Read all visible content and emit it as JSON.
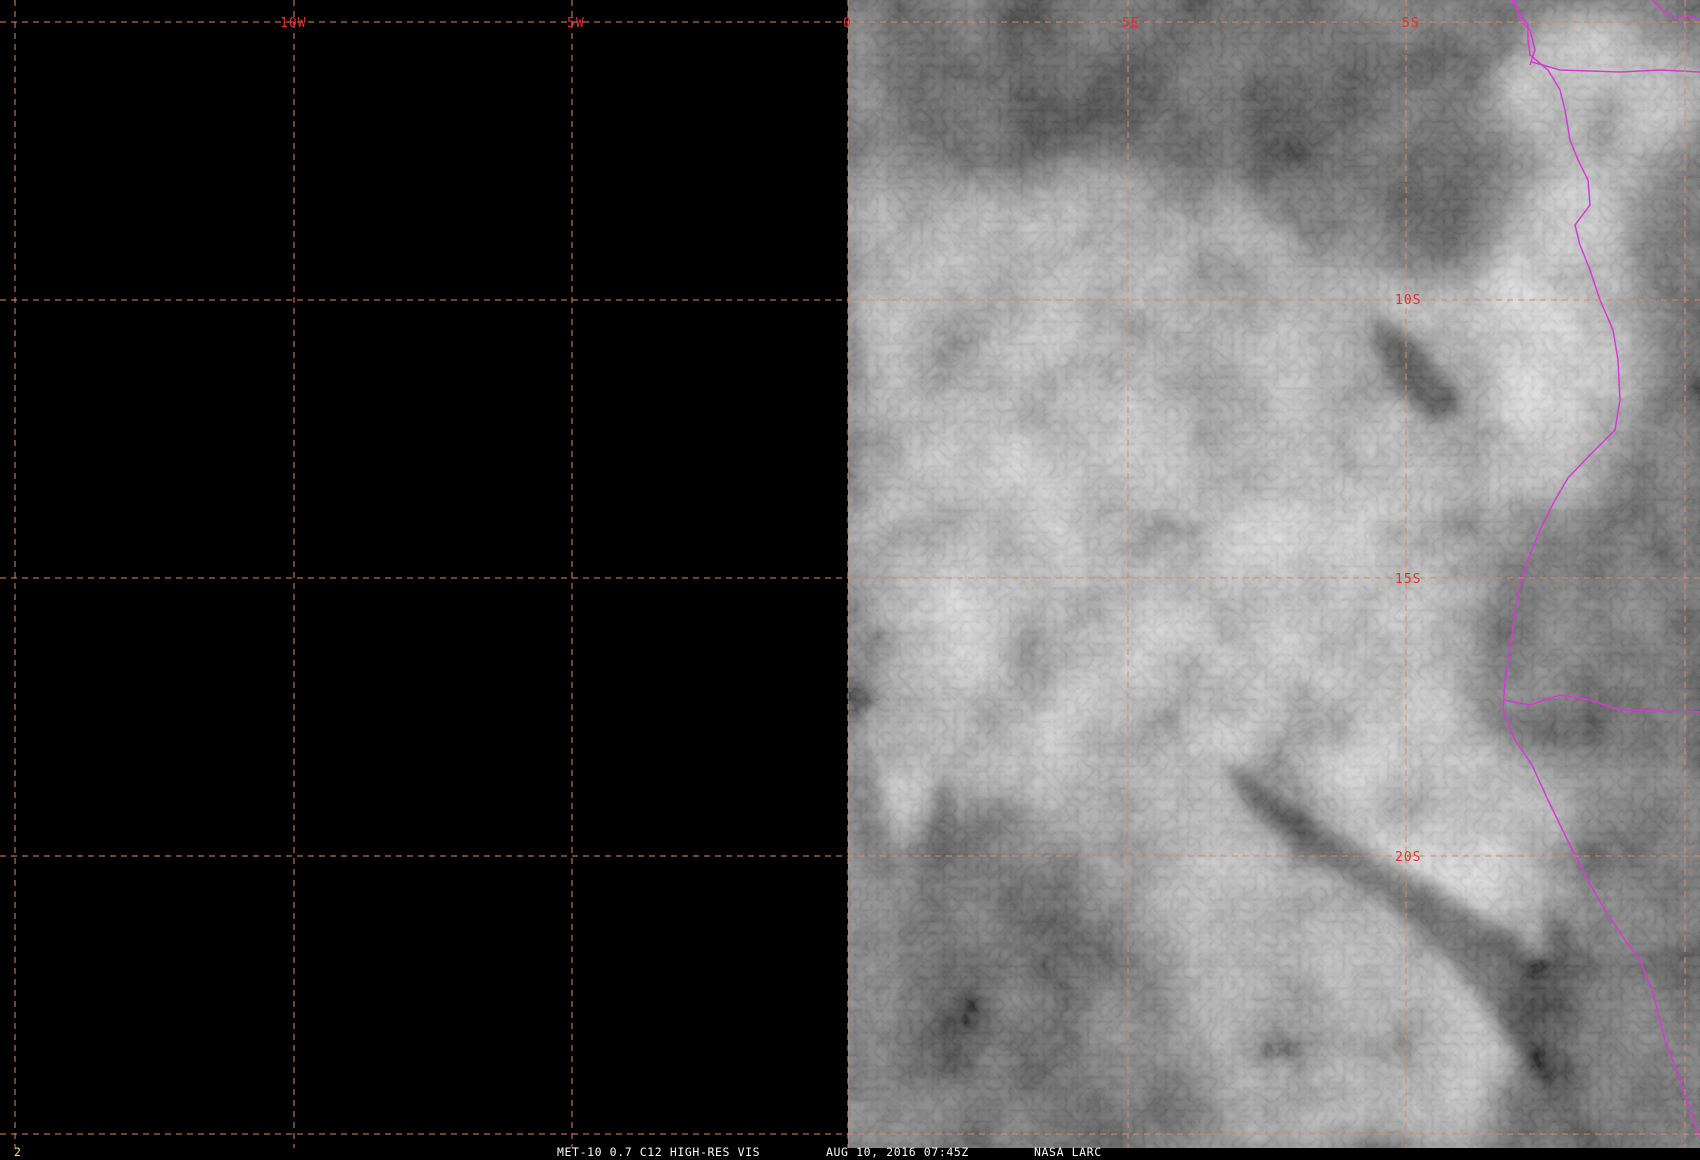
{
  "image": {
    "description_hidden": false,
    "frame_number": "2",
    "caption": {
      "satellite_band": "MET-10 0.7 C12 HIGH-RES VIS",
      "datetime": "AUG 10, 2016 07:45Z",
      "agency": "NASA LARC"
    },
    "grid_labels": {
      "longitudes": [
        "10W",
        "5W",
        "0",
        "5E"
      ],
      "latitudes": [
        "5S",
        "10S",
        "15S",
        "20S"
      ]
    },
    "colors": {
      "grid": "#d98a66",
      "grid_label": "#e0302e",
      "border": "#d63ad6",
      "caption": "#ffffff",
      "frame_number": "#ffe66d",
      "no_data": "#000000"
    }
  }
}
